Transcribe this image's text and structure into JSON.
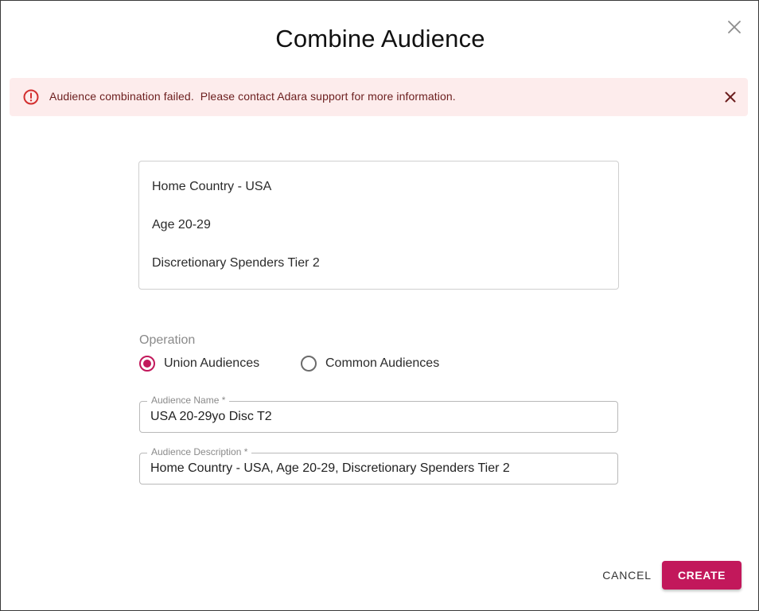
{
  "dialog": {
    "title": "Combine Audience",
    "close_icon": "close-icon"
  },
  "alert": {
    "message": "Audience combination failed.  Please contact Adara support for more information.",
    "icon": "error-outline-icon",
    "close_icon": "close-icon",
    "colors": {
      "background": "#fdecec",
      "icon": "#d32f2f",
      "text": "#6b1d1d"
    }
  },
  "audiences": [
    "Home Country - USA",
    "Age 20-29",
    "Discretionary Spenders Tier 2"
  ],
  "operation": {
    "label": "Operation",
    "options": [
      {
        "label": "Union Audiences",
        "selected": true
      },
      {
        "label": "Common Audiences",
        "selected": false
      }
    ]
  },
  "fields": {
    "name": {
      "label": "Audience Name *",
      "value": "USA 20-29yo Disc T2"
    },
    "description": {
      "label": "Audience Description *",
      "value": "Home Country - USA, Age 20-29, Discretionary Spenders Tier 2"
    }
  },
  "actions": {
    "cancel_label": "CANCEL",
    "create_label": "CREATE"
  },
  "colors": {
    "accent": "#c2185b"
  }
}
